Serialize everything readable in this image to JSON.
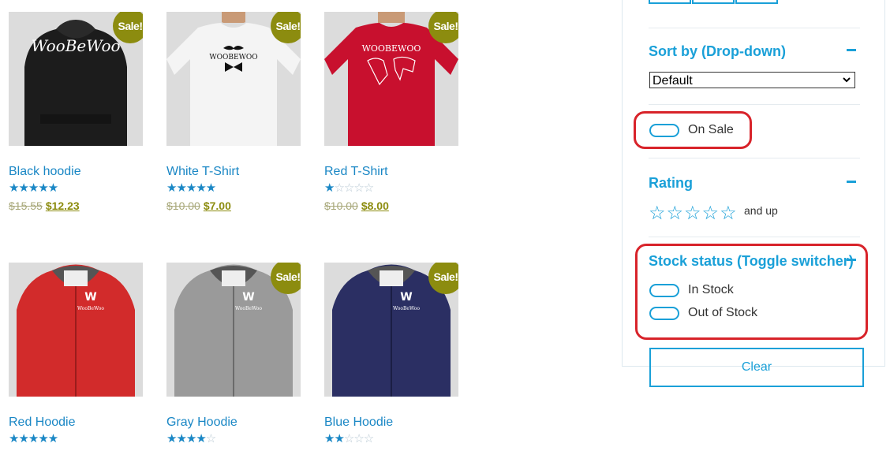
{
  "products": [
    {
      "name": "Black hoodie",
      "sale_badge": "Sale!",
      "rating": 5,
      "price_old": "$15.55",
      "price_new": "$12.23",
      "print": "WooBeWoo"
    },
    {
      "name": "White T-Shirt",
      "sale_badge": "Sale!",
      "rating": 5,
      "price_old": "$10.00",
      "price_new": "$7.00",
      "print": "WOOBEWOO"
    },
    {
      "name": "Red T-Shirt",
      "sale_badge": "Sale!",
      "rating": 1,
      "price_old": "$10.00",
      "price_new": "$8.00",
      "print": "WOOBEWOO"
    },
    {
      "name": "Red Hoodie",
      "sale_badge": "",
      "rating": 5,
      "price_old": "",
      "price_new": "",
      "print": "WooBeWoo"
    },
    {
      "name": "Gray Hoodie",
      "sale_badge": "Sale!",
      "rating": 4,
      "price_old": "",
      "price_new": "",
      "print": "WooBeWoo"
    },
    {
      "name": "Blue Hoodie",
      "sale_badge": "Sale!",
      "rating": 2,
      "price_old": "",
      "price_new": "",
      "print": "WooBeWoo"
    }
  ],
  "filters": {
    "sort": {
      "title": "Sort by (Drop-down)",
      "selected": "Default"
    },
    "on_sale": {
      "label": "On Sale"
    },
    "rating": {
      "title": "Rating",
      "suffix": "and up",
      "stars": "☆☆☆☆☆"
    },
    "stock": {
      "title": "Stock status (Toggle switcher)",
      "options": [
        "In Stock",
        "Out of Stock"
      ]
    },
    "clear_label": "Clear"
  },
  "colors": {
    "accent": "#1aa0d8",
    "link": "#1a87c5",
    "sale": "#8c8c0f",
    "highlight": "#d8232a"
  }
}
